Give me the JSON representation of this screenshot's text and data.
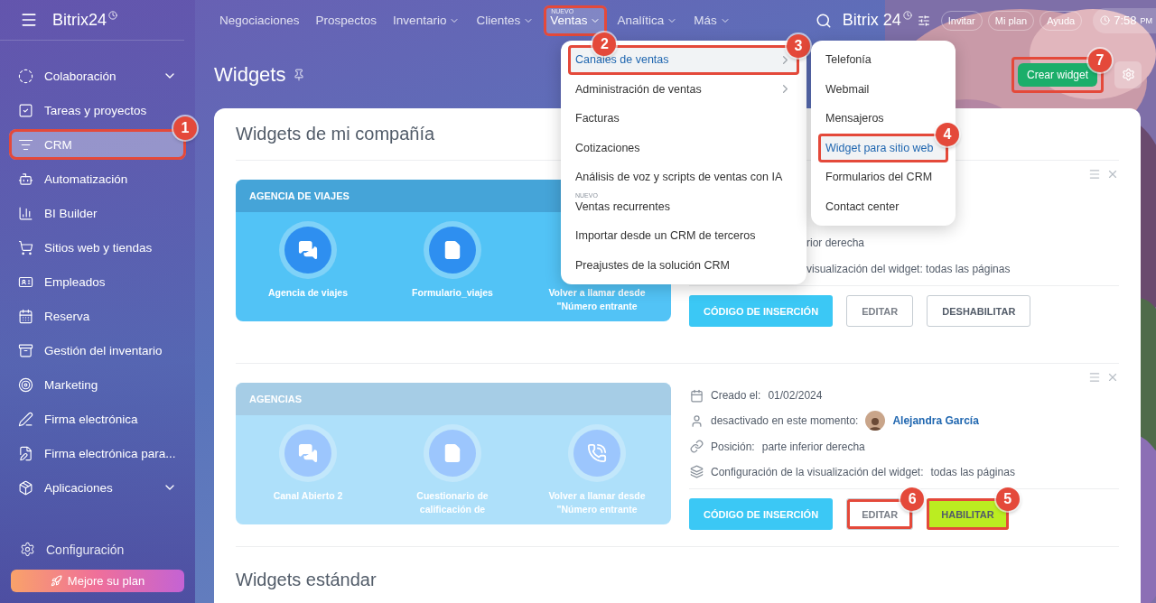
{
  "sidebar": {
    "logo": "Bitrix24",
    "items": [
      {
        "label": "Colaboración",
        "expandable": true,
        "selected": false
      },
      {
        "label": "Tareas y proyectos",
        "expandable": false,
        "selected": false
      },
      {
        "label": "CRM",
        "expandable": false,
        "selected": true,
        "callout": "1"
      },
      {
        "label": "Automatización",
        "expandable": false,
        "selected": false
      },
      {
        "label": "BI Builder",
        "expandable": false,
        "selected": false
      },
      {
        "label": "Sitios web y tiendas",
        "expandable": false,
        "selected": false
      },
      {
        "label": "Empleados",
        "expandable": false,
        "selected": false
      },
      {
        "label": "Reserva",
        "expandable": false,
        "selected": false
      },
      {
        "label": "Gestión del inventario",
        "expandable": false,
        "selected": false
      },
      {
        "label": "Marketing",
        "expandable": false,
        "selected": false
      },
      {
        "label": "Firma electrónica",
        "expandable": false,
        "selected": false
      },
      {
        "label": "Firma electrónica para...",
        "expandable": false,
        "selected": false
      },
      {
        "label": "Aplicaciones",
        "expandable": true,
        "selected": false
      }
    ],
    "settings": "Configuración",
    "upgrade_button": "Mejore su plan"
  },
  "topbar": {
    "nav": [
      {
        "label": "Negociaciones",
        "dropdown": false,
        "selected": false
      },
      {
        "label": "Prospectos",
        "dropdown": false,
        "selected": false
      },
      {
        "label": "Inventario",
        "dropdown": true,
        "selected": false
      },
      {
        "label": "Clientes",
        "dropdown": true,
        "selected": false
      },
      {
        "label": "Ventas",
        "dropdown": true,
        "selected": true,
        "badge": "NUEVO",
        "callout": "2"
      },
      {
        "label": "Analítica",
        "dropdown": true,
        "selected": false
      },
      {
        "label": "Más",
        "dropdown": true,
        "selected": false
      }
    ],
    "logo": "Bitrix 24",
    "buttons": [
      "Invitar",
      "Mi plan",
      "Ayuda"
    ],
    "time": "7:58",
    "time_suffix": "PM"
  },
  "page": {
    "title": "Widgets",
    "create_button": {
      "label": "Crear widget",
      "callout": "7"
    }
  },
  "section_title": "Widgets de mi compañía",
  "widgets": [
    {
      "name": "AGENCIA DE VIAJES",
      "enabled": true,
      "channels": [
        {
          "label": "Agencia de viajes",
          "covered": false
        },
        {
          "label": "Formulario_viajes",
          "covered": false
        },
        {
          "label": "Volver a llamar desde \"Número entrante",
          "covered": true
        }
      ],
      "info": [
        {
          "kind": "partial",
          "text": "rior derecha"
        },
        {
          "kind": "partial",
          "text": "visualización del widget:  todas las páginas"
        }
      ],
      "buttons": [
        {
          "label": "CÓDIGO DE INSERCIÓN",
          "kind": "primary"
        },
        {
          "label": "EDITAR",
          "kind": "outline"
        },
        {
          "label": "DESHABILITAR",
          "kind": "outline-dark"
        }
      ]
    },
    {
      "name": "AGENCIAS",
      "enabled": false,
      "channels": [
        {
          "label": "Canal Abierto 2",
          "covered": false
        },
        {
          "label": "Cuestionario de calificación de",
          "covered": false
        },
        {
          "label": "Volver a llamar desde \"Número entrante",
          "covered": false
        }
      ],
      "info": [
        {
          "kind": "date",
          "label": "Creado el:",
          "value": "01/02/2024"
        },
        {
          "kind": "user",
          "label": "desactivado en este momento:",
          "value": "Alejandra García"
        },
        {
          "kind": "position",
          "label": "Posición:",
          "value": "parte inferior derecha"
        },
        {
          "kind": "display",
          "label": "Configuración de la visualización del widget:",
          "value": "todas las páginas"
        }
      ],
      "buttons": [
        {
          "label": "CÓDIGO DE INSERCIÓN",
          "kind": "primary"
        },
        {
          "label": "EDITAR",
          "kind": "outline",
          "callout": "6"
        },
        {
          "label": "HABILITAR",
          "kind": "success",
          "callout": "5"
        }
      ]
    }
  ],
  "standard_title": "Widgets estándar",
  "sales_menu": [
    {
      "label": "Canales de ventas",
      "submenu": true,
      "selected": true,
      "callout": "3"
    },
    {
      "label": "Administración de ventas",
      "submenu": true,
      "selected": false
    },
    {
      "label": "Facturas",
      "submenu": false,
      "selected": false
    },
    {
      "label": "Cotizaciones",
      "submenu": false,
      "selected": false
    },
    {
      "label": "Análisis de voz y scripts de ventas con IA",
      "submenu": false,
      "selected": false
    },
    {
      "label": "Ventas recurrentes",
      "submenu": false,
      "selected": false,
      "badge": "NUEVO"
    },
    {
      "label": "Importar desde un CRM de terceros",
      "submenu": false,
      "selected": false
    },
    {
      "label": "Preajustes de la solución CRM",
      "submenu": false,
      "selected": false
    }
  ],
  "channels_menu": [
    {
      "label": "Telefonía",
      "selected": false
    },
    {
      "label": "Webmail",
      "selected": false
    },
    {
      "label": "Mensajeros",
      "selected": false
    },
    {
      "label": "Widget para sitio web",
      "selected": true,
      "callout": "4"
    },
    {
      "label": "Formularios del CRM",
      "selected": false
    },
    {
      "label": "Contact center",
      "selected": false
    }
  ]
}
